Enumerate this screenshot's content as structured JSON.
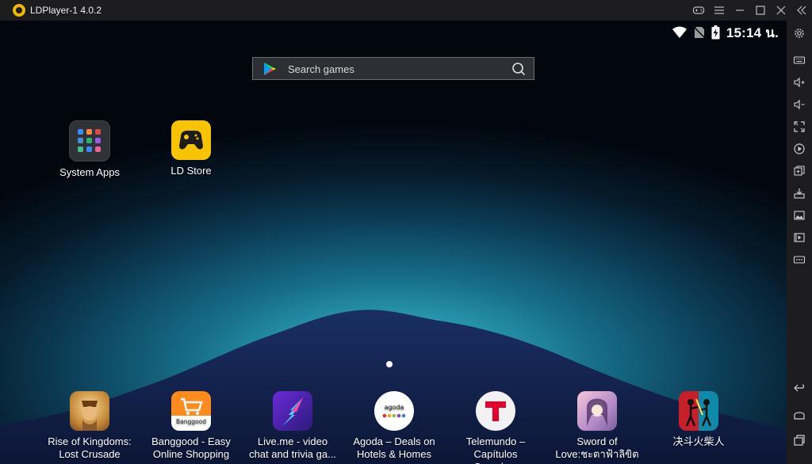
{
  "window": {
    "title": "LDPlayer-1 4.0.2"
  },
  "titlebar_icons": [
    "gamepad-icon",
    "menu-icon",
    "minimize-icon",
    "maximize-icon",
    "close-icon",
    "collapse-icon"
  ],
  "status": {
    "time": "15:14 น."
  },
  "search": {
    "placeholder": "Search games"
  },
  "desktop_apps": [
    {
      "label": "System Apps",
      "icon": "system-apps-folder-icon"
    },
    {
      "label": "LD Store",
      "icon": "ld-store-icon"
    }
  ],
  "dock_apps": [
    {
      "label_line1": "Rise of Kingdoms:",
      "label_line2": "Lost Crusade"
    },
    {
      "label_line1": "Banggood - Easy",
      "label_line2": "Online Shopping",
      "icon_text": "Banggood"
    },
    {
      "label_line1": "Live.me - video",
      "label_line2": "chat and trivia ga..."
    },
    {
      "label_line1": "Agoda – Deals on",
      "label_line2": "Hotels & Homes",
      "icon_text": "agoda"
    },
    {
      "label_line1": "Telemundo –",
      "label_line2": "Capítulos Comple..."
    },
    {
      "label_line1": "Sword of",
      "label_line2": "Love:ชะตาฟ้าลิขิต"
    },
    {
      "label_line1": "决斗火柴人",
      "label_line2": ""
    }
  ],
  "sidebar_icons": [
    "settings-icon",
    "keyboard-icon",
    "volume-up-icon",
    "volume-down-icon",
    "fullscreen-icon",
    "record-icon",
    "multi-instance-icon",
    "install-apk-icon",
    "screenshot-icon",
    "video-icon",
    "more-icon",
    "back-icon",
    "home-icon",
    "recent-apps-icon"
  ],
  "colors": {
    "titlebar": "#1d1d1f",
    "accent": "#f5b800"
  }
}
